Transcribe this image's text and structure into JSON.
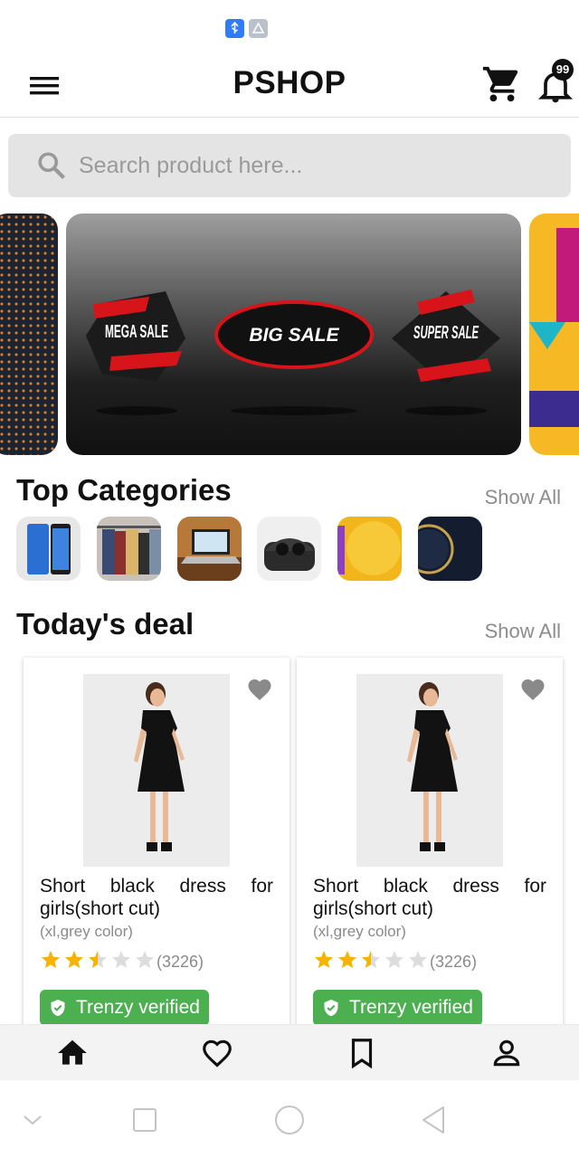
{
  "status_bar": {
    "icons": [
      "usb-icon",
      "app-notification-icon"
    ]
  },
  "header": {
    "title": "PSHOP",
    "notification_count": "99"
  },
  "search": {
    "placeholder": "Search product here..."
  },
  "banner": {
    "slides": [
      "MEGA SALE",
      "BIG SALE",
      "SUPER SALE"
    ]
  },
  "categories": {
    "title": "Top Categories",
    "show_all": "Show All",
    "items": [
      "phone",
      "clothes",
      "laptop",
      "earbuds",
      "promo",
      "sale"
    ]
  },
  "deals": {
    "title": "Today's deal",
    "show_all": "Show All",
    "products": [
      {
        "title": "Short black dress for girls(short cut)",
        "subtitle": "(xl,grey color)",
        "rating": 2.5,
        "max_rating": 5,
        "reviews": "(3226)",
        "badge": "Trenzy verified"
      },
      {
        "title": "Short black dress for girls(short cut)",
        "subtitle": "(xl,grey color)",
        "rating": 2.5,
        "max_rating": 5,
        "reviews": "(3226)",
        "badge": "Trenzy verified"
      }
    ]
  },
  "bottom_nav": {
    "items": [
      "home-icon",
      "heart-icon",
      "bookmark-icon",
      "account-icon"
    ],
    "active": "home-icon"
  },
  "colors": {
    "accent_green": "#4caf50",
    "star": "#f6b300",
    "star_empty": "#dddddd",
    "text": "#111111",
    "muted": "#8c8c8c"
  }
}
